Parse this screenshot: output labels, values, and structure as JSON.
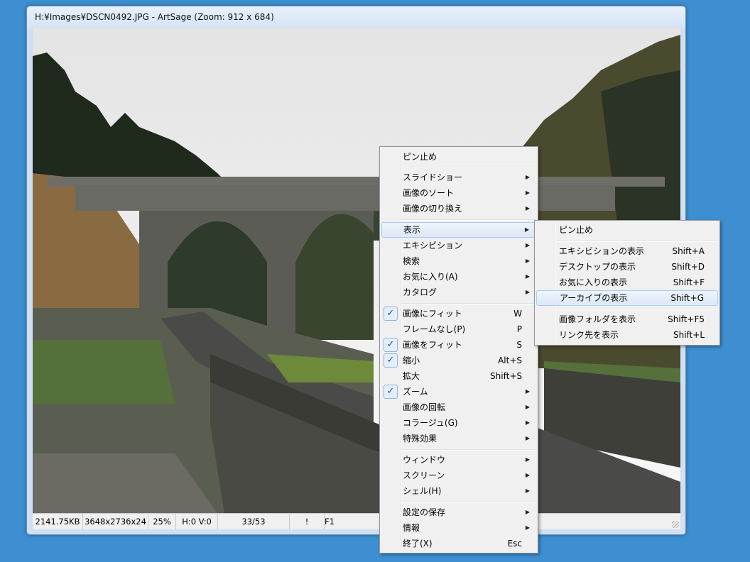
{
  "window": {
    "title": "H:¥Images¥DSCN0492.JPG - ArtSage (Zoom: 912 x 684)"
  },
  "statusbar": {
    "cells": [
      "2141.75KB",
      "3648x2736x24",
      "25%",
      "H:0 V:0",
      "33/53",
      "!",
      "F1"
    ]
  },
  "context_menu": {
    "items": [
      {
        "label": "ピン止め"
      },
      {
        "label": "スライドショー",
        "submenu": true
      },
      {
        "label": "画像のソート",
        "submenu": true
      },
      {
        "label": "画像の切り換え",
        "submenu": true
      },
      {
        "label": "表示",
        "submenu": true,
        "highlighted": true
      },
      {
        "label": "エキシビション",
        "submenu": true
      },
      {
        "label": "検索",
        "submenu": true
      },
      {
        "label": "お気に入り(A)",
        "submenu": true
      },
      {
        "label": "カタログ",
        "submenu": true
      },
      {
        "label": "画像にフィット",
        "shortcut": "W",
        "checked": true
      },
      {
        "label": "フレームなし(P)",
        "shortcut": "P"
      },
      {
        "label": "画像をフィット",
        "shortcut": "S",
        "checked": true
      },
      {
        "label": "縮小",
        "shortcut": "Alt+S",
        "checked": true
      },
      {
        "label": "拡大",
        "shortcut": "Shift+S"
      },
      {
        "label": "ズーム",
        "submenu": true,
        "checked": true
      },
      {
        "label": "画像の回転",
        "submenu": true
      },
      {
        "label": "コラージュ(G)",
        "submenu": true
      },
      {
        "label": "特殊効果",
        "submenu": true
      },
      {
        "label": "ウィンドウ",
        "submenu": true
      },
      {
        "label": "スクリーン",
        "submenu": true
      },
      {
        "label": "シェル(H)",
        "submenu": true
      },
      {
        "label": "設定の保存",
        "submenu": true
      },
      {
        "label": "情報",
        "submenu": true
      },
      {
        "label": "終了(X)",
        "shortcut": "Esc"
      }
    ]
  },
  "view_submenu": {
    "items": [
      {
        "label": "ピン止め"
      },
      {
        "label": "エキシビションの表示",
        "shortcut": "Shift+A"
      },
      {
        "label": "デスクトップの表示",
        "shortcut": "Shift+D"
      },
      {
        "label": "お気に入りの表示",
        "shortcut": "Shift+F"
      },
      {
        "label": "アーカイブの表示",
        "shortcut": "Shift+G",
        "highlighted": true
      },
      {
        "label": "画像フォルダを表示",
        "shortcut": "Shift+F5"
      },
      {
        "label": "リンク先を表示",
        "shortcut": "Shift+L"
      }
    ]
  },
  "icons": {
    "submenu_arrow": "▶",
    "check": "✓"
  },
  "colors": {
    "desktop": "#3d8fd1",
    "menu_bg": "#f0f0f0",
    "highlight_border": "#aaccf1"
  }
}
